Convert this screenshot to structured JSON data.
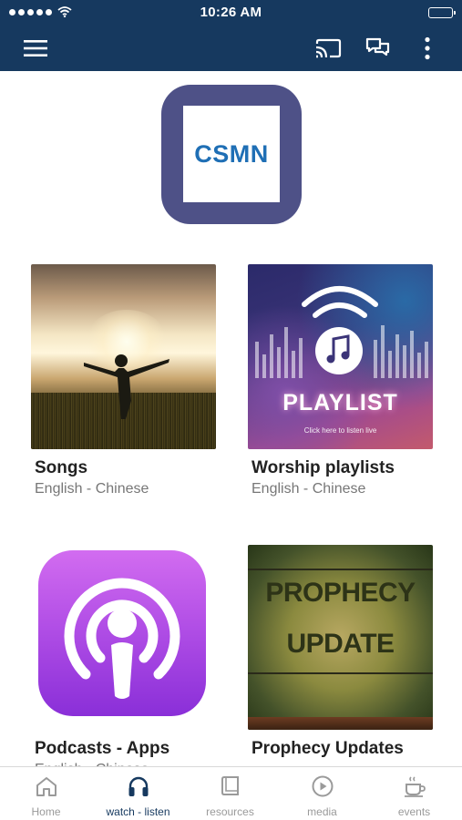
{
  "status_bar": {
    "time": "10:26 AM"
  },
  "app_bar": {
    "menu_icon": "hamburger-menu-icon",
    "cast_icon": "cast-icon",
    "chat_icon": "chat-bubbles-icon",
    "more_icon": "more-vertical-icon"
  },
  "logo": {
    "text": "CSMN"
  },
  "cards": [
    {
      "title": "Songs",
      "subtitle": "English - Chinese"
    },
    {
      "title": "Worship playlists",
      "subtitle": "English - Chinese",
      "image_title": "PLAYLIST",
      "image_caption": "Click here to listen live"
    },
    {
      "title": "Podcasts - Apps",
      "subtitle": "English - Chinese"
    },
    {
      "title": "Prophecy Updates",
      "image_line1": "PROPHECY",
      "image_line2": "UPDATE"
    }
  ],
  "bottom_nav": {
    "active": "watch - listen",
    "items": [
      {
        "label": "Home",
        "icon": "home-icon"
      },
      {
        "label": "watch - listen",
        "icon": "headphones-icon"
      },
      {
        "label": "resources",
        "icon": "book-icon"
      },
      {
        "label": "media",
        "icon": "play-circle-icon"
      },
      {
        "label": "events",
        "icon": "coffee-cup-icon"
      }
    ]
  },
  "colors": {
    "primary": "#16395f",
    "logo_bg": "#4e5187",
    "logo_text": "#1f6fb5",
    "podcast_purple": "#b24fe6"
  }
}
